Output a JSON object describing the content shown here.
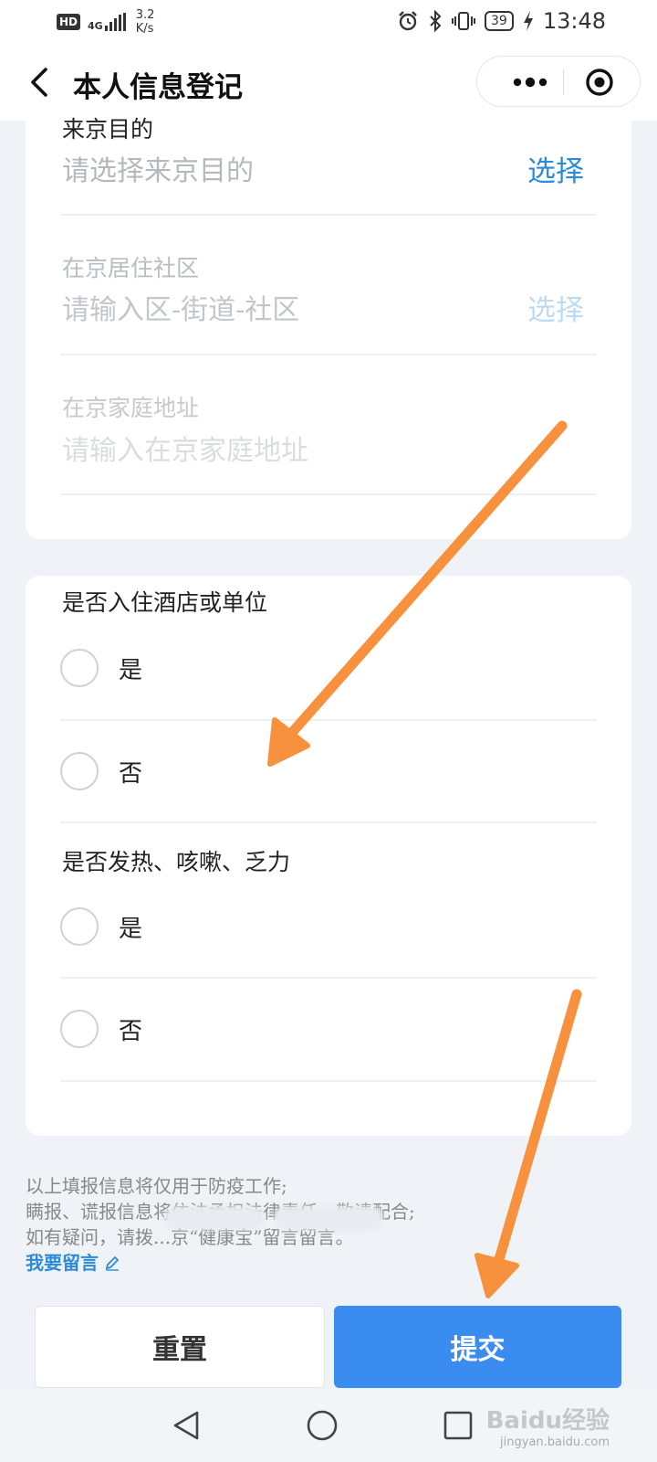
{
  "status_bar": {
    "hd": "HD",
    "net_type": "4G",
    "speed_value": "3.2",
    "speed_unit": "K/s",
    "battery": "39",
    "time": "13:48"
  },
  "nav": {
    "title": "本人信息登记"
  },
  "fields": [
    {
      "label": "来京目的",
      "placeholder": "请选择来京目的",
      "action": "选择"
    },
    {
      "label": "在京居住社区",
      "placeholder": "请输入区-街道-社区",
      "action": "选择"
    },
    {
      "label": "在京家庭地址",
      "placeholder": "请输入在京家庭地址"
    }
  ],
  "questions": [
    {
      "title": "是否入住酒店或单位",
      "options": [
        "是",
        "否"
      ]
    },
    {
      "title": "是否发热、咳嗽、乏力",
      "options": [
        "是",
        "否"
      ]
    }
  ],
  "notice": {
    "line1": "以上填报信息将仅用于防疫工作;",
    "line2": "瞒报、谎报信息将依法承担法律责任，敬请配合;",
    "line3": "如有疑问，请拨...京“健康宝”留言留言。",
    "leave_message": "我要留言"
  },
  "buttons": {
    "reset": "重置",
    "submit": "提交"
  },
  "watermark": {
    "logo": "Baidu经验",
    "url": "jingyan.baidu.com"
  },
  "colors": {
    "accent": "#2d8ad6",
    "submit_bg": "#3b8cf0",
    "arrow": "#f7913d",
    "page_bg": "#eff2f6"
  }
}
